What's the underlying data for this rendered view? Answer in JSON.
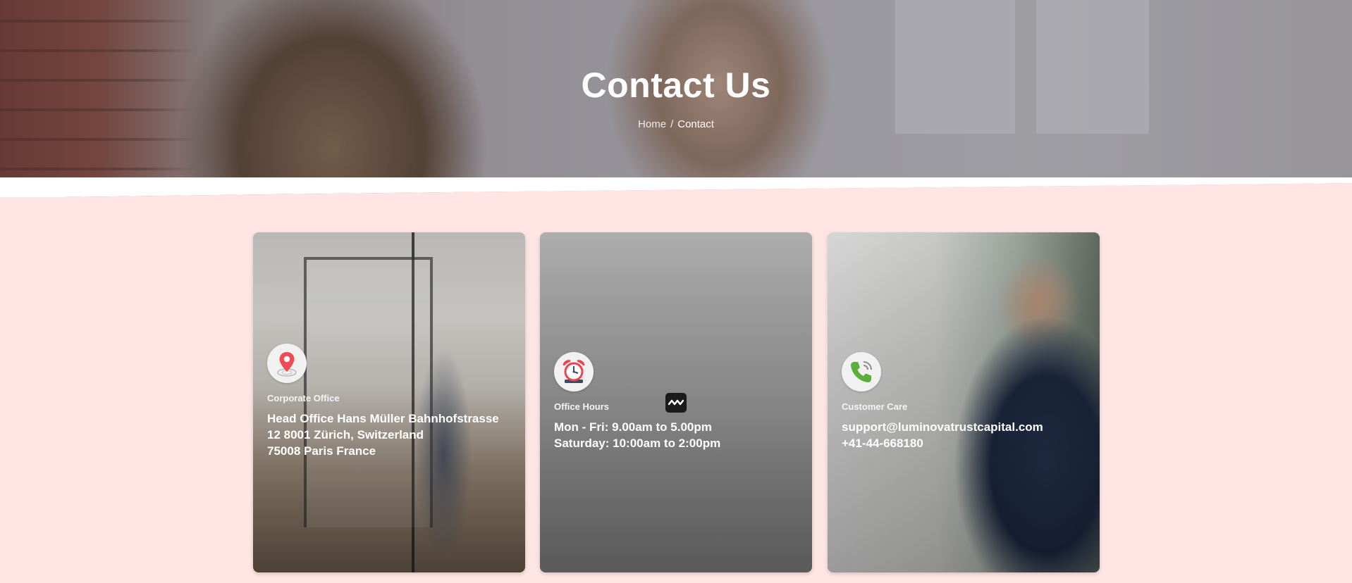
{
  "hero": {
    "title": "Contact Us",
    "breadcrumb": {
      "home": "Home",
      "separator": "/",
      "current": "Contact"
    }
  },
  "cards": [
    {
      "icon": "map-pin-icon",
      "label": "Corporate Office",
      "lines": [
        "Head Office Hans Müller Bahnhofstrasse",
        "12 8001 Zürich, Switzerland",
        "75008 Paris France"
      ]
    },
    {
      "icon": "alarm-clock-icon",
      "label": "Office Hours",
      "lines": [
        "Mon - Fri: 9.00am to 5.00pm",
        "Saturday: 10:00am to 2:00pm"
      ]
    },
    {
      "icon": "phone-icon",
      "label": "Customer Care",
      "lines": [
        "support@luminovatrustcapital.com",
        "+41-44-668180"
      ]
    }
  ],
  "chat_widget": {
    "icon": "chat-widget-icon"
  },
  "colors": {
    "page_background": "#ffe6e4",
    "pin_red": "#ef4b55",
    "phone_green": "#5aae3c",
    "clock_red": "#e8454d"
  }
}
